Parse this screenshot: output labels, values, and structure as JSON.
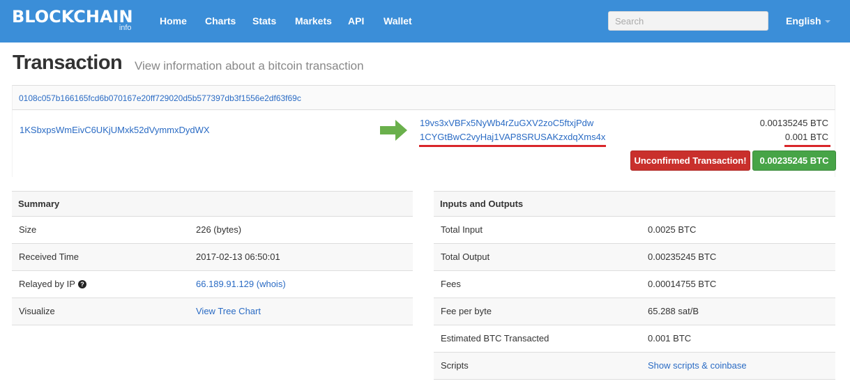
{
  "nav": {
    "brand": "BLOCKCHAIN",
    "brand_sub": "info",
    "items": [
      "Home",
      "Charts",
      "Stats",
      "Markets",
      "API",
      "Wallet"
    ],
    "search_placeholder": "Search",
    "language": "English"
  },
  "header": {
    "title": "Transaction",
    "subtitle": "View information about a bitcoin transaction"
  },
  "tx": {
    "hash": "0108c057b166165fcd6b070167e20ff729020d5b577397db3f1556e2df63f69c",
    "input_address": "1KSbxpsWmEivC6UKjUMxk52dVymmxDydWX",
    "outputs": [
      {
        "address": "19vs3xVBFx5NyWb4rZuGXV2zoC5ftxjPdw",
        "amount": "0.00135245 BTC"
      },
      {
        "address": "1CYGtBwC2vyHaj1VAP8SRUSAKzxdqXms4x",
        "amount": "0.001 BTC"
      }
    ],
    "status_label": "Unconfirmed Transaction!",
    "total_label": "0.00235245 BTC",
    "colors": {
      "highlight": "#d9262a",
      "status_red": "#c9302c",
      "total_green": "#47a447",
      "nav_blue": "#3b8ed8"
    }
  },
  "summary": {
    "heading": "Summary",
    "rows": [
      {
        "label": "Size",
        "value": "226 (bytes)"
      },
      {
        "label": "Received Time",
        "value": "2017-02-13 06:50:01"
      },
      {
        "label": "Relayed by IP",
        "value": "66.189.91.129 (whois)"
      },
      {
        "label": "Visualize",
        "value": "View Tree Chart"
      }
    ],
    "help_icon": "?"
  },
  "io": {
    "heading": "Inputs and Outputs",
    "rows": [
      {
        "label": "Total Input",
        "value": "0.0025 BTC"
      },
      {
        "label": "Total Output",
        "value": "0.00235245 BTC"
      },
      {
        "label": "Fees",
        "value": "0.00014755 BTC"
      },
      {
        "label": "Fee per byte",
        "value": "65.288 sat/B"
      },
      {
        "label": "Estimated BTC Transacted",
        "value": "0.001 BTC"
      },
      {
        "label": "Scripts",
        "value": "Show scripts & coinbase"
      }
    ]
  }
}
